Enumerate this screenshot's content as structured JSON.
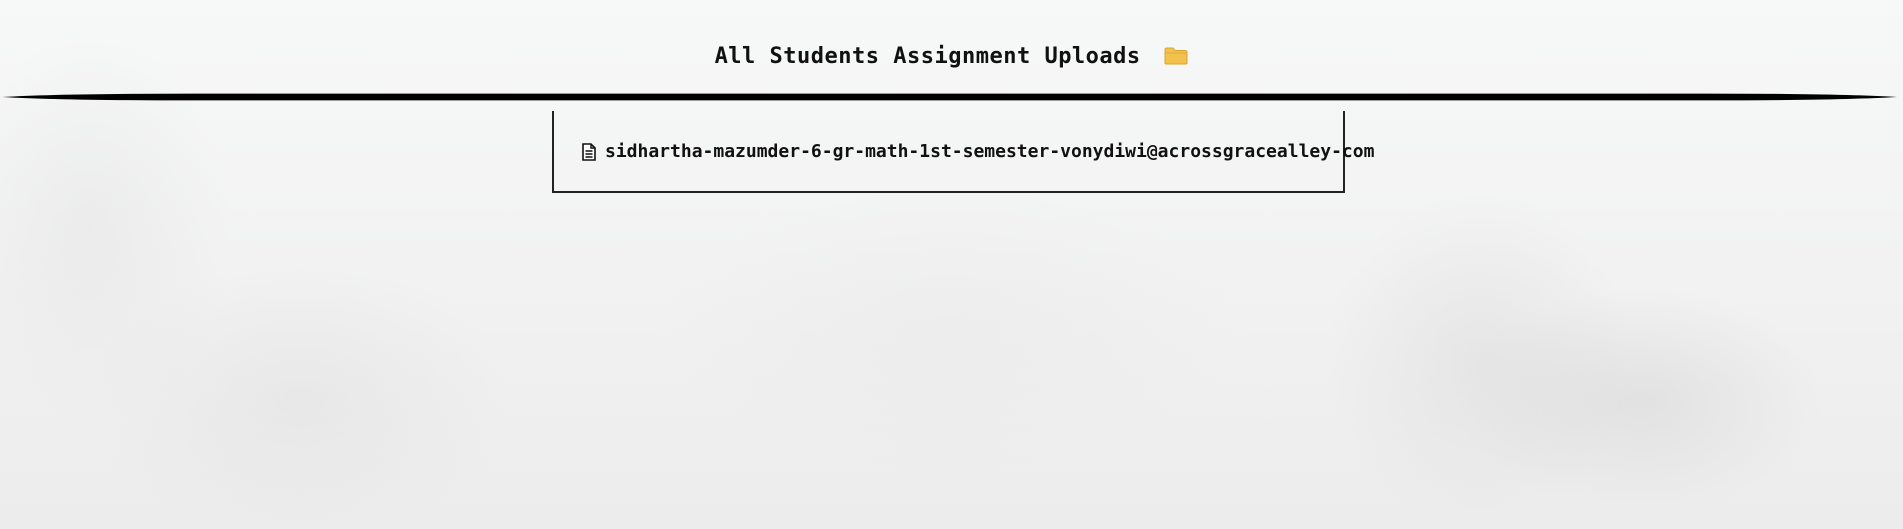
{
  "header": {
    "title": "All Students Assignment Uploads",
    "icon": "folder-icon"
  },
  "uploads": {
    "items": [
      {
        "icon": "document-icon",
        "name": "sidhartha-mazumder-6-gr-math-1st-semester-vonydiwi@acrossgracealley-com"
      }
    ]
  },
  "colors": {
    "text": "#111111",
    "folder": "#f2c14e",
    "divider": "#000000"
  }
}
